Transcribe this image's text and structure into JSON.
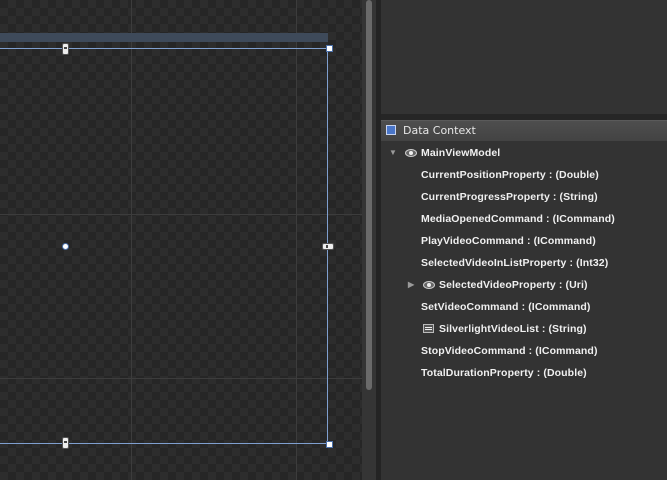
{
  "data_context": {
    "title": "Data Context",
    "root": {
      "label": "MainViewModel",
      "icon": "object-eye-icon",
      "expanded": true
    },
    "properties": [
      {
        "label": "CurrentPositionProperty : (Double)",
        "icon": null,
        "expandable": false
      },
      {
        "label": "CurrentProgressProperty : (String)",
        "icon": null,
        "expandable": false
      },
      {
        "label": "MediaOpenedCommand : (ICommand)",
        "icon": null,
        "expandable": false
      },
      {
        "label": "PlayVideoCommand : (ICommand)",
        "icon": null,
        "expandable": false
      },
      {
        "label": "SelectedVideoInListProperty : (Int32)",
        "icon": null,
        "expandable": false
      },
      {
        "label": "SelectedVideoProperty : (Uri)",
        "icon": "object-eye-icon",
        "expandable": true
      },
      {
        "label": "SetVideoCommand : (ICommand)",
        "icon": null,
        "expandable": false
      },
      {
        "label": "SilverlightVideoList : (String)",
        "icon": "list-icon",
        "expandable": false
      },
      {
        "label": "StopVideoCommand : (ICommand)",
        "icon": null,
        "expandable": false
      },
      {
        "label": "TotalDurationProperty : (Double)",
        "icon": null,
        "expandable": false
      }
    ]
  },
  "glyphs": {
    "expanded_arrow": "▼",
    "collapsed_arrow": "▶"
  },
  "colors": {
    "selection_border": "#7f9fcf",
    "header_icon": "#4a76c9"
  }
}
